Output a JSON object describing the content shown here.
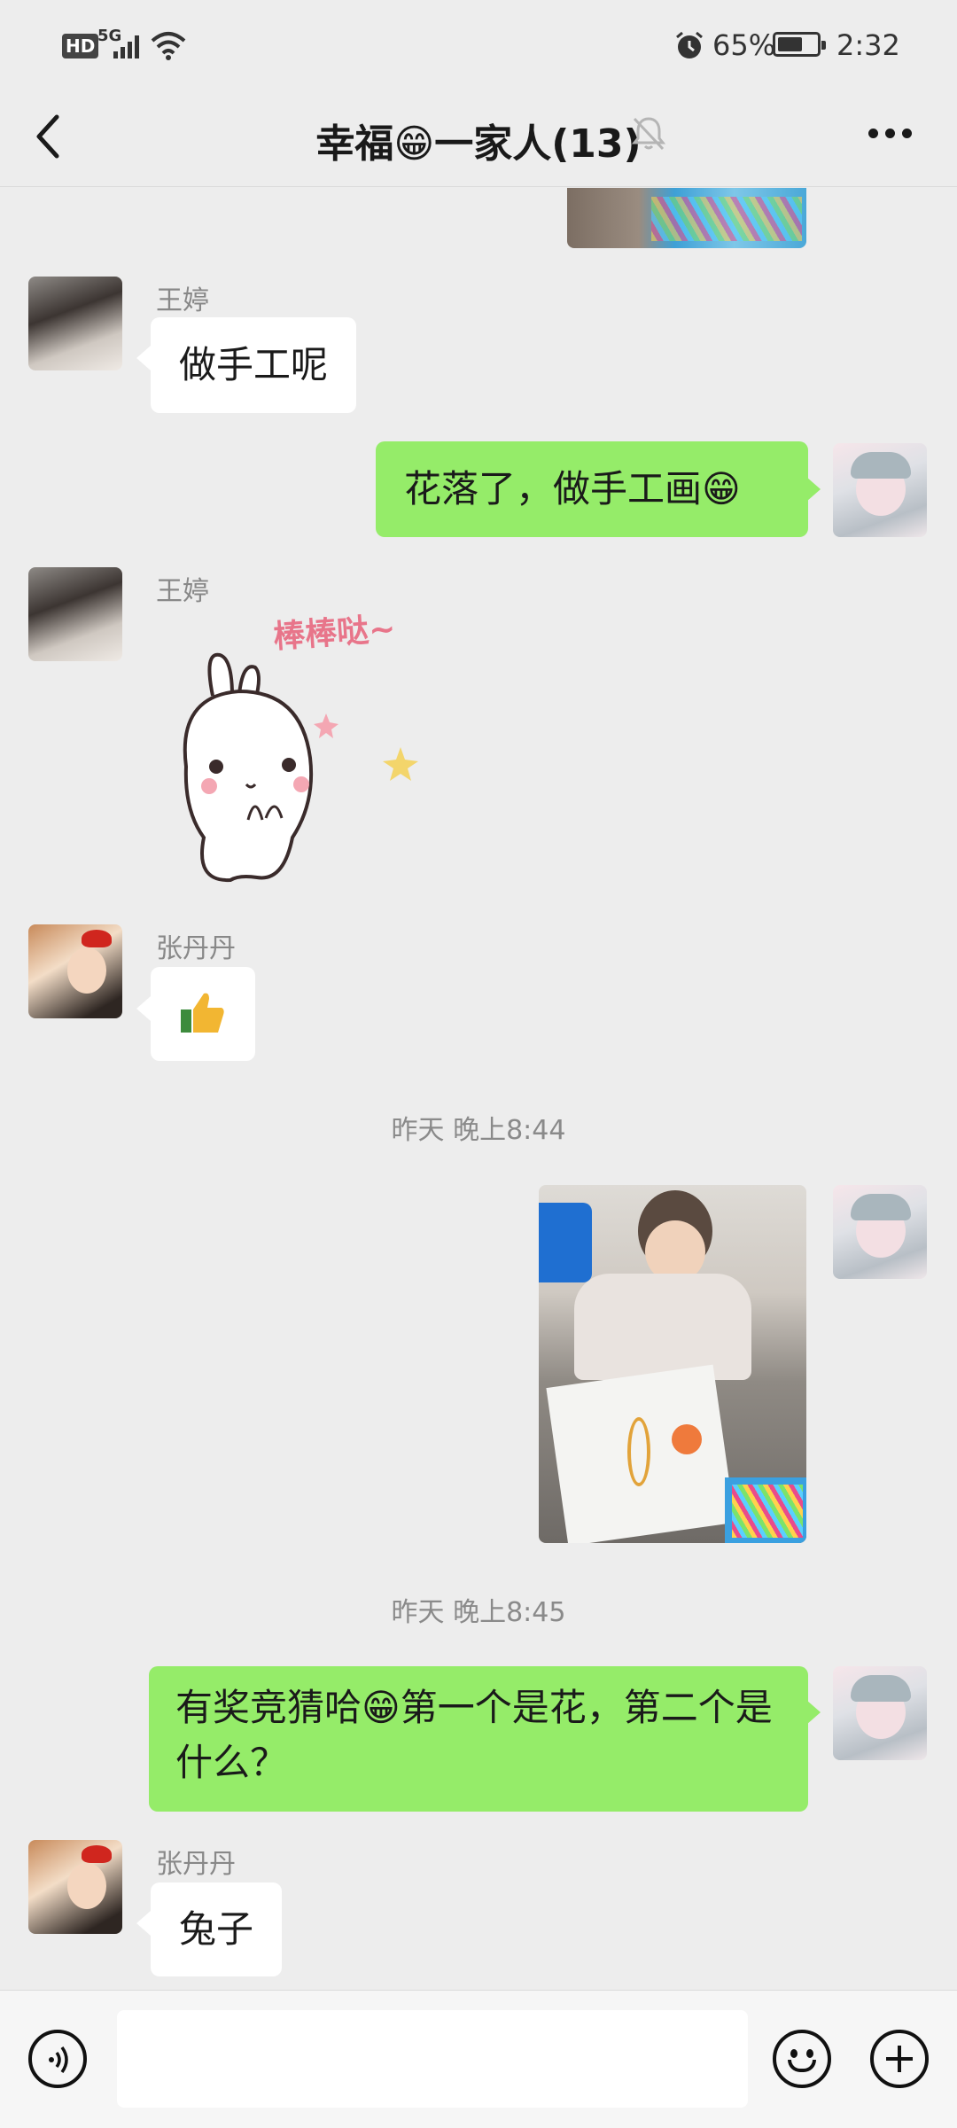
{
  "status_bar": {
    "hd": "HD",
    "network": "5G",
    "battery_percent": "65%",
    "time": "2:32",
    "battery_level": 0.65
  },
  "header": {
    "title": "幸福😁一家人(13)",
    "icons": [
      "back-icon",
      "muted-bell-icon",
      "more-icon"
    ]
  },
  "messages": [
    {
      "sender": "王婷",
      "side": "left",
      "type": "text",
      "text": "做手工呢"
    },
    {
      "side": "right",
      "type": "text",
      "text": "花落了，做手工画😁"
    },
    {
      "sender": "王婷",
      "side": "left",
      "type": "sticker",
      "sticker_text": "棒棒哒~"
    },
    {
      "sender": "张丹丹",
      "side": "left",
      "type": "emoji",
      "text": "👍"
    },
    {
      "type": "timestamp",
      "text": "昨天 晚上8:44"
    },
    {
      "side": "right",
      "type": "image"
    },
    {
      "type": "timestamp",
      "text": "昨天 晚上8:45"
    },
    {
      "side": "right",
      "type": "text",
      "text": "有奖竞猜哈😁第一个是花，第二个是什么？"
    },
    {
      "sender": "张丹丹",
      "side": "left",
      "type": "text",
      "text": "兔子"
    }
  ],
  "bottom_bar": {
    "input_value": "",
    "icons": [
      "voice-icon",
      "emoji-icon",
      "plus-icon"
    ]
  },
  "colors": {
    "background": "#ededed",
    "my_bubble": "#95ec69",
    "other_bubble": "#ffffff"
  }
}
